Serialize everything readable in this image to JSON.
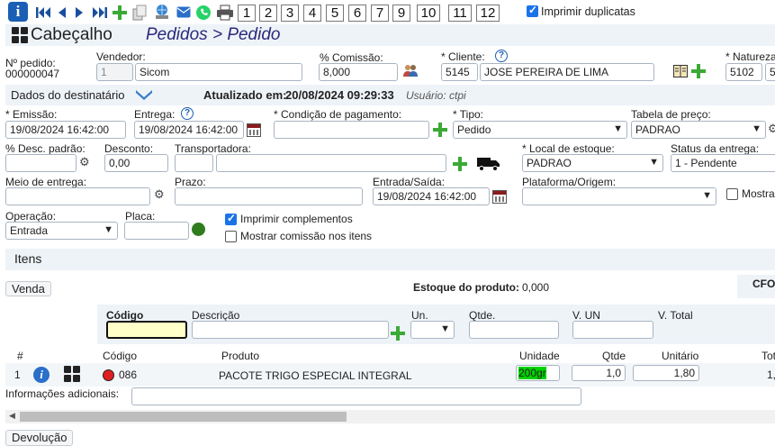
{
  "toolbar": {
    "info_icon": "info-icon",
    "page_numbers": [
      "1",
      "2",
      "3",
      "4",
      "5",
      "6",
      "7",
      "9",
      "10",
      "11",
      "12"
    ],
    "imprimir_duplicatas_label": "Imprimir duplicatas",
    "imprimir_duplicatas_checked": true
  },
  "header": {
    "section": "Cabeçalho",
    "breadcrumb": "Pedidos > Pedido"
  },
  "fields": {
    "numero_pedido_label": "Nº pedido:",
    "numero_pedido_value": "000000047",
    "vendedor_label": "Vendedor:",
    "vendedor_id": "1",
    "vendedor_nome": "Sicom",
    "comissao_label": "% Comissão:",
    "comissao_value": "8,000",
    "cliente_label": "* Cliente:",
    "cliente_id": "5145",
    "cliente_nome": "JOSE PEREIRA DE LIMA",
    "natureza_label": "* Natureza",
    "natureza_value": "5102",
    "natureza_extra": "5"
  },
  "destinatario": {
    "label": "Dados do destinatário",
    "atualizado_label": "Atualizado em:",
    "atualizado_value": "20/08/2024 09:29:33",
    "usuario": "Usuário: ctpi"
  },
  "form": {
    "emissao_label": "* Emissão:",
    "emissao_value": "19/08/2024 16:42:00",
    "entrega_label": "Entrega:",
    "entrega_value": "19/08/2024 16:42:00",
    "condicao_label": "* Condição de pagamento:",
    "tipo_label": "* Tipo:",
    "tipo_value": "Pedido",
    "tabela_label": "Tabela de preço:",
    "tabela_value": "PADRAO",
    "desc_label": "% Desc. padrão:",
    "desconto_label": "Desconto:",
    "desconto_value": "0,00",
    "transportadora_label": "Transportadora:",
    "local_label": "* Local de estoque:",
    "local_value": "PADRAO",
    "status_label": "Status da entrega:",
    "status_value": "1 - Pendente",
    "meio_label": "Meio de entrega:",
    "prazo_label": "Prazo:",
    "entrada_saida_label": "Entrada/Saída:",
    "entrada_saida_value": "19/08/2024 16:42:00",
    "plataforma_label": "Plataforma/Origem:",
    "mostrar_label": "Mostra",
    "operacao_label": "Operação:",
    "operacao_value": "Entrada",
    "placa_label": "Placa:",
    "imprimir_complementos_label": "Imprimir complementos",
    "imprimir_complementos_checked": true,
    "mostrar_comissao_label": "Mostrar comissão nos itens",
    "mostrar_comissao_checked": false
  },
  "itens": {
    "title": "Itens",
    "venda_button": "Venda",
    "estoque_label": "Estoque do produto:",
    "estoque_value": "0,000",
    "cfo_label": "CFO",
    "entry_headers": {
      "codigo": "Código",
      "descricao": "Descrição",
      "un": "Un.",
      "qtde": "Qtde.",
      "v_un": "V. UN",
      "v_total": "V. Total"
    },
    "table_headers": {
      "num": "#",
      "codigo": "Código",
      "produto": "Produto",
      "unidade": "Unidade",
      "qtde": "Qtde",
      "unitario": "Unitário",
      "total": "Tot"
    },
    "rows": [
      {
        "num": "1",
        "codigo": "086",
        "produto": "PACOTE TRIGO ESPECIAL INTEGRAL",
        "unidade": "200gr",
        "qtde": "1,0",
        "unitario": "1,80",
        "total": "1,"
      }
    ],
    "info_adicionais_label": "Informações adicionais:",
    "devolucao_button": "Devolução"
  },
  "colors": {
    "section_bg": "#eef3f8",
    "breadcrumb": "#2b2a7a",
    "add_green": "#3aaa35",
    "unidade_highlight": "#00d200",
    "codigo_input_bg": "#ffffc8",
    "status_dot": "#e02020"
  }
}
